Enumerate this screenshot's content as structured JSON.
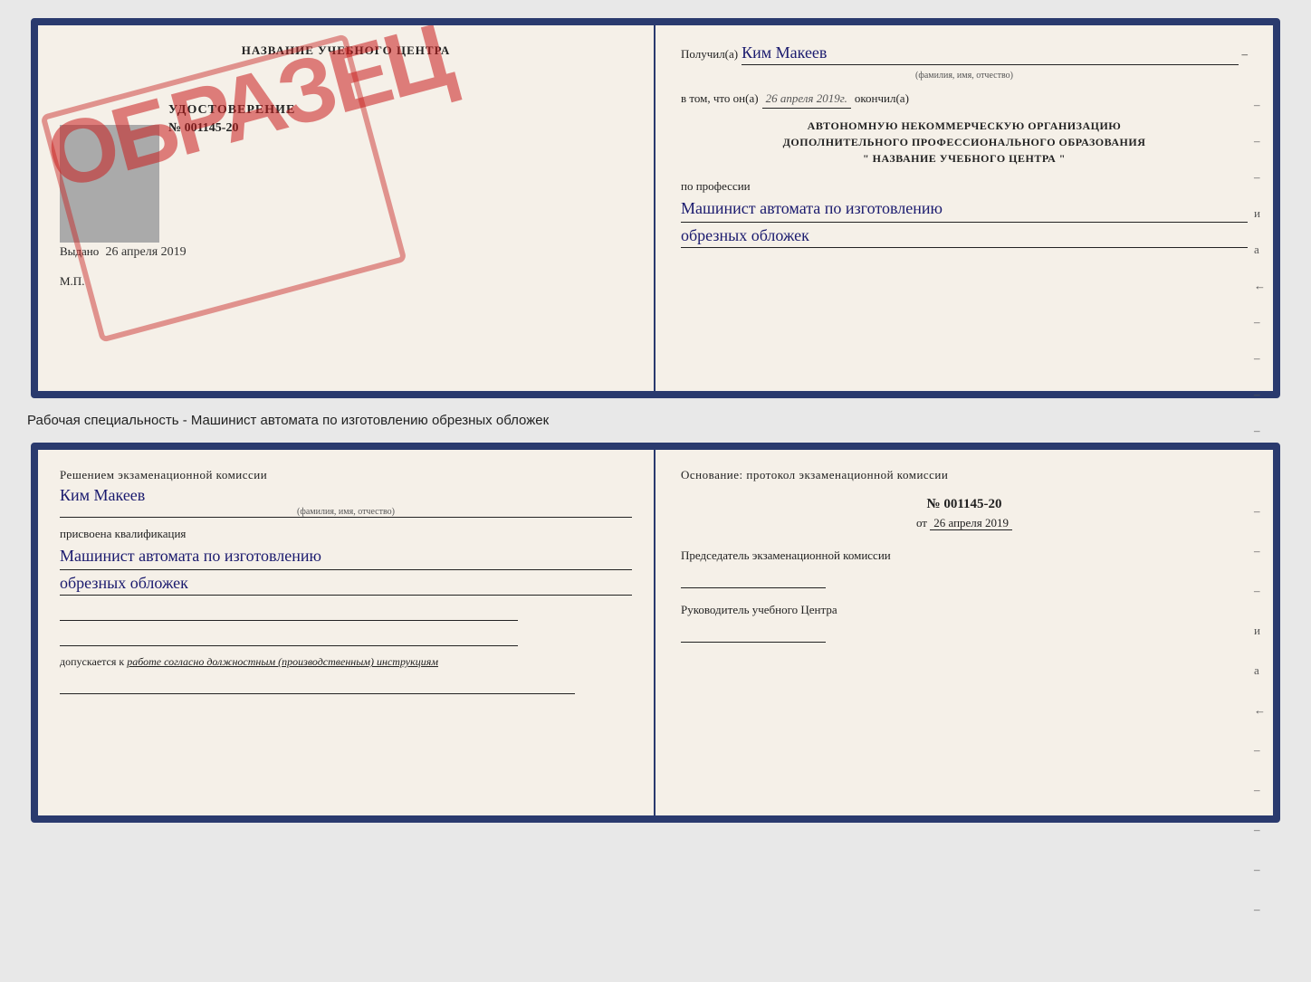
{
  "top_doc": {
    "left": {
      "school_title": "НАЗВАНИЕ УЧЕБНОГО ЦЕНТРА",
      "udostoverenie_label": "УДОСТОВЕРЕНИЕ",
      "number": "№ 001145-20",
      "vydano_label": "Выдано",
      "vydano_date": "26 апреля 2019",
      "mp_label": "М.П.",
      "stamp_text": "ОБРАЗЕЦ"
    },
    "right": {
      "poluchil_label": "Получил(а)",
      "recipient_name": "Ким Макеев",
      "fio_hint": "(фамилия, имя, отчество)",
      "vtom_label": "в том, что он(а)",
      "completion_date": "26 апреля 2019г.",
      "okonchil_label": "окончил(а)",
      "org_line1": "АВТОНОМНУЮ НЕКОММЕРЧЕСКУЮ ОРГАНИЗАЦИЮ",
      "org_line2": "ДОПОЛНИТЕЛЬНОГО ПРОФЕССИОНАЛЬНОГО ОБРАЗОВАНИЯ",
      "org_line3": "\"   НАЗВАНИЕ УЧЕБНОГО ЦЕНТРА   \"",
      "po_professii_label": "по профессии",
      "professiya_line1": "Машинист автомата по изготовлению",
      "professiya_line2": "обрезных обложек",
      "dash1": "–",
      "dash2": "–",
      "dash3": "–",
      "letter_i": "и",
      "letter_a": "а",
      "arrow": "←",
      "dash4": "–",
      "dash5": "–",
      "dash6": "–",
      "dash7": "–"
    }
  },
  "caption": "Рабочая специальность - Машинист автомата по изготовлению обрезных обложек",
  "bottom_doc": {
    "left": {
      "resheniem_label": "Решением экзаменационной комиссии",
      "recipient_name": "Ким Макеев",
      "fio_hint": "(фамилия, имя, отчество)",
      "prisvoyena_label": "присвоена квалификация",
      "kvali_line1": "Машинист автомата по изготовлению",
      "kvali_line2": "обрезных обложек",
      "dopuskaetsya_prefix": "допускается к",
      "dopuskaetsya_text": "работе согласно должностным (производственным) инструкциям"
    },
    "right": {
      "osnovanie_label": "Основание: протокол экзаменационной комиссии",
      "protocol_number": "№  001145-20",
      "ot_label": "от",
      "ot_date": "26 апреля 2019",
      "predsedatel_label": "Председатель экзаменационной комиссии",
      "rukovoditel_label": "Руководитель учебного Центра",
      "dash1": "–",
      "dash2": "–",
      "dash3": "–",
      "letter_i": "и",
      "letter_a": "а",
      "arrow": "←",
      "dash4": "–",
      "dash5": "–",
      "dash6": "–",
      "dash7": "–",
      "dash8": "–"
    }
  }
}
